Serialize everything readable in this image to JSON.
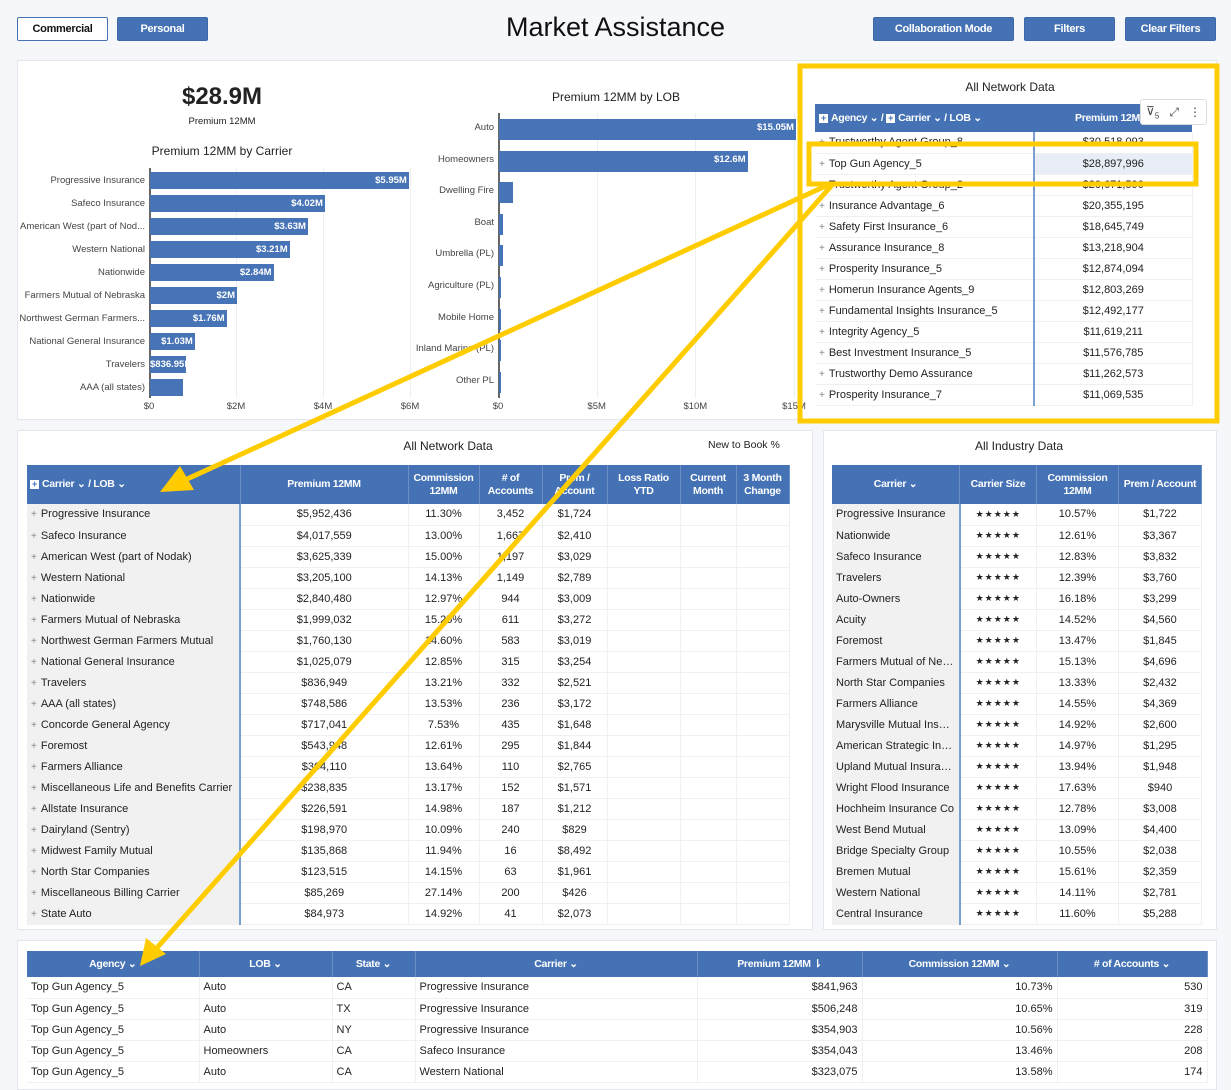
{
  "header": {
    "title": "Market Assistance",
    "tabs": [
      "Commercial",
      "Personal"
    ],
    "active_tab": "Commercial",
    "buttons": [
      "Collaboration Mode",
      "Filters",
      "Clear Filters"
    ]
  },
  "colors": {
    "accent": "#4472b4",
    "bar": "#4674b6",
    "annotation": "#ffcc00"
  },
  "kpi": {
    "value": "$28.9M",
    "label": "Premium 12MM"
  },
  "chart_data": [
    {
      "type": "bar",
      "orientation": "horizontal",
      "title": "Premium 12MM by Carrier",
      "categories": [
        "Progressive Insurance",
        "Safeco Insurance",
        "American West (part of Nod...",
        "Western National",
        "Nationwide",
        "Farmers Mutual of Nebraska",
        "Northwest German Farmers...",
        "National General Insurance",
        "Travelers",
        "AAA (all states)"
      ],
      "values": [
        5.95,
        4.02,
        3.63,
        3.21,
        2.84,
        2.0,
        1.76,
        1.03,
        0.837,
        0.749
      ],
      "data_labels": [
        "$5.95M",
        "$4.02M",
        "$3.63M",
        "$3.21M",
        "$2.84M",
        "$2M",
        "$1.76M",
        "$1.03M",
        "$836.95k",
        ""
      ],
      "xlim": [
        0,
        6
      ],
      "xticks": [
        "$0",
        "$2M",
        "$4M",
        "$6M"
      ],
      "unit": "$M",
      "grid": true
    },
    {
      "type": "bar",
      "orientation": "horizontal",
      "title": "Premium 12MM by LOB",
      "categories": [
        "Auto",
        "Homeowners",
        "Dwelling Fire",
        "Boat",
        "Umbrella (PL)",
        "Agriculture (PL)",
        "Mobile Home",
        "Inland Marine (PL)",
        "Other PL"
      ],
      "values": [
        15.05,
        12.6,
        0.7,
        0.2,
        0.2,
        0.12,
        0.05,
        0.04,
        0.03
      ],
      "data_labels": [
        "$15.05M",
        "$12.6M",
        "",
        "",
        "",
        "",
        "",
        "",
        ""
      ],
      "xlim": [
        0,
        15
      ],
      "xticks": [
        "$0",
        "$5M",
        "$10M",
        "$15M"
      ],
      "unit": "$M",
      "grid": true
    }
  ],
  "network_agency": {
    "title": "All Network Data",
    "header": [
      "Agency",
      "Carrier",
      "LOB",
      "Premium 12MM"
    ],
    "filter_count": "5",
    "highlight": "Top Gun Agency_5",
    "rows": [
      [
        "Trustworthy Agent Group_8",
        "$30,518,093"
      ],
      [
        "Top Gun Agency_5",
        "$28,897,996"
      ],
      [
        "Trustworthy Agent Group_2",
        "$20,671,590"
      ],
      [
        "Insurance Advantage_6",
        "$20,355,195"
      ],
      [
        "Safety First Insurance_6",
        "$18,645,749"
      ],
      [
        "Assurance Insurance_8",
        "$13,218,904"
      ],
      [
        "Prosperity Insurance_5",
        "$12,874,094"
      ],
      [
        "Homerun Insurance Agents_9",
        "$12,803,269"
      ],
      [
        "Fundamental Insights Insurance_5",
        "$12,492,177"
      ],
      [
        "Integrity Agency_5",
        "$11,619,211"
      ],
      [
        "Best Investment Insurance_5",
        "$11,576,785"
      ],
      [
        "Trustworthy Demo Assurance",
        "$11,262,573"
      ],
      [
        "Prosperity Insurance_7",
        "$11,069,535"
      ]
    ]
  },
  "network_carrier": {
    "title": "All Network Data",
    "new_to_book": "New to Book %",
    "header": [
      "Carrier",
      "LOB",
      "Premium 12MM",
      "Commission 12MM",
      "# of Accounts",
      "Prem / Account",
      "Loss Ratio YTD",
      "Current Month",
      "3 Month Change"
    ],
    "rows": [
      [
        "Progressive Insurance",
        "$5,952,436",
        "11.30%",
        "3,452",
        "$1,724"
      ],
      [
        "Safeco Insurance",
        "$4,017,559",
        "13.00%",
        "1,667",
        "$2,410"
      ],
      [
        "American West (part of Nodak)",
        "$3,625,339",
        "15.00%",
        "1,197",
        "$3,029"
      ],
      [
        "Western National",
        "$3,205,100",
        "14.13%",
        "1,149",
        "$2,789"
      ],
      [
        "Nationwide",
        "$2,840,480",
        "12.97%",
        "944",
        "$3,009"
      ],
      [
        "Farmers Mutual of Nebraska",
        "$1,999,032",
        "15.25%",
        "611",
        "$3,272"
      ],
      [
        "Northwest German Farmers Mutual",
        "$1,760,130",
        "14.60%",
        "583",
        "$3,019"
      ],
      [
        "National General Insurance",
        "$1,025,079",
        "12.85%",
        "315",
        "$3,254"
      ],
      [
        "Travelers",
        "$836,949",
        "13.21%",
        "332",
        "$2,521"
      ],
      [
        "AAA (all states)",
        "$748,586",
        "13.53%",
        "236",
        "$3,172"
      ],
      [
        "Concorde General Agency",
        "$717,041",
        "7.53%",
        "435",
        "$1,648"
      ],
      [
        "Foremost",
        "$543,948",
        "12.61%",
        "295",
        "$1,844"
      ],
      [
        "Farmers Alliance",
        "$304,110",
        "13.64%",
        "110",
        "$2,765"
      ],
      [
        "Miscellaneous Life and Benefits Carrier",
        "$238,835",
        "13.17%",
        "152",
        "$1,571"
      ],
      [
        "Allstate Insurance",
        "$226,591",
        "14.98%",
        "187",
        "$1,212"
      ],
      [
        "Dairyland (Sentry)",
        "$198,970",
        "10.09%",
        "240",
        "$829"
      ],
      [
        "Midwest Family Mutual",
        "$135,868",
        "11.94%",
        "16",
        "$8,492"
      ],
      [
        "North Star Companies",
        "$123,515",
        "14.15%",
        "63",
        "$1,961"
      ],
      [
        "Miscellaneous Billing Carrier",
        "$85,269",
        "27.14%",
        "200",
        "$426"
      ],
      [
        "State Auto",
        "$84,973",
        "14.92%",
        "41",
        "$2,073"
      ]
    ]
  },
  "industry": {
    "title": "All Industry Data",
    "header": [
      "Carrier",
      "Carrier Size",
      "Commission 12MM",
      "Prem / Account"
    ],
    "stars": "★★★★★",
    "rows": [
      [
        "Progressive Insurance",
        "10.57%",
        "$1,722"
      ],
      [
        "Nationwide",
        "12.61%",
        "$3,367"
      ],
      [
        "Safeco Insurance",
        "12.83%",
        "$3,832"
      ],
      [
        "Travelers",
        "12.39%",
        "$3,760"
      ],
      [
        "Auto-Owners",
        "16.18%",
        "$3,299"
      ],
      [
        "Acuity",
        "14.52%",
        "$4,560"
      ],
      [
        "Foremost",
        "13.47%",
        "$1,845"
      ],
      [
        "Farmers Mutual of Neb...",
        "15.13%",
        "$4,696"
      ],
      [
        "North Star Companies",
        "13.33%",
        "$2,432"
      ],
      [
        "Farmers Alliance",
        "14.55%",
        "$4,369"
      ],
      [
        "Marysville Mutual Insur...",
        "14.92%",
        "$2,600"
      ],
      [
        "American Strategic Ins...",
        "14.97%",
        "$1,295"
      ],
      [
        "Upland Mutual Insuran...",
        "13.94%",
        "$1,948"
      ],
      [
        "Wright Flood Insurance",
        "17.63%",
        "$940"
      ],
      [
        "Hochheim Insurance Co",
        "12.78%",
        "$3,008"
      ],
      [
        "West Bend Mutual",
        "13.09%",
        "$4,400"
      ],
      [
        "Bridge Specialty Group",
        "10.55%",
        "$2,038"
      ],
      [
        "Bremen Mutual",
        "15.61%",
        "$2,359"
      ],
      [
        "Western National",
        "14.11%",
        "$2,781"
      ],
      [
        "Central Insurance",
        "11.60%",
        "$5,288"
      ]
    ]
  },
  "detail": {
    "header": [
      "Agency",
      "LOB",
      "State",
      "Carrier",
      "Premium 12MM",
      "Commission 12MM",
      "# of Accounts"
    ],
    "rows": [
      [
        "Top Gun Agency_5",
        "Auto",
        "CA",
        "Progressive Insurance",
        "$841,963",
        "10.73%",
        "530"
      ],
      [
        "Top Gun Agency_5",
        "Auto",
        "TX",
        "Progressive Insurance",
        "$506,248",
        "10.65%",
        "319"
      ],
      [
        "Top Gun Agency_5",
        "Auto",
        "NY",
        "Progressive Insurance",
        "$354,903",
        "10.56%",
        "228"
      ],
      [
        "Top Gun Agency_5",
        "Homeowners",
        "CA",
        "Safeco Insurance",
        "$354,043",
        "13.46%",
        "208"
      ],
      [
        "Top Gun Agency_5",
        "Auto",
        "CA",
        "Western National",
        "$323,075",
        "13.58%",
        "174"
      ]
    ]
  }
}
